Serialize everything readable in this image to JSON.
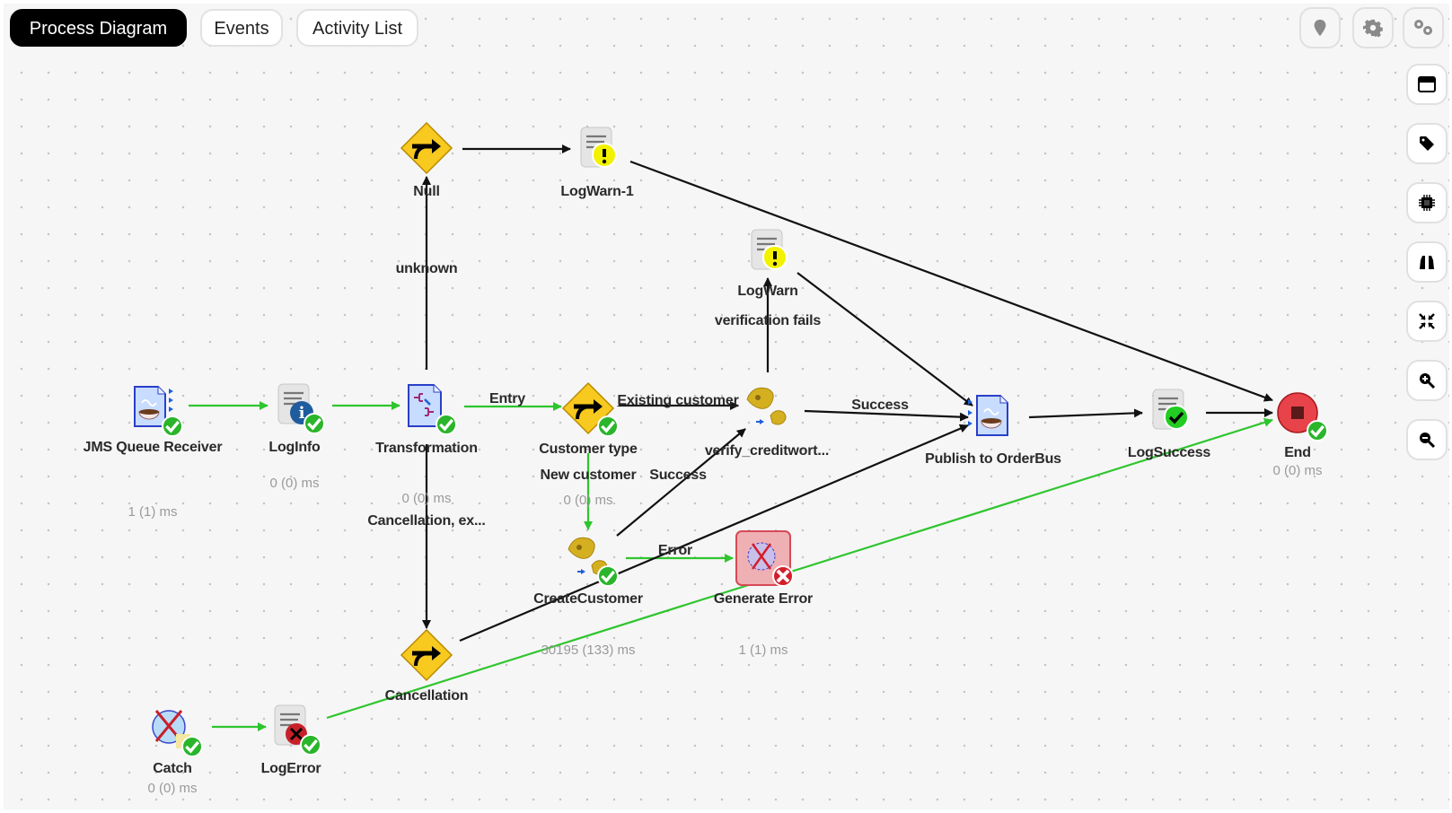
{
  "tabs": [
    {
      "label": "Process Diagram",
      "active": true
    },
    {
      "label": "Events",
      "active": false
    },
    {
      "label": "Activity List",
      "active": false
    }
  ],
  "top_tools": [
    {
      "icon": "map-pin-icon",
      "label": "Location"
    },
    {
      "icon": "gear-icon",
      "label": "Settings"
    },
    {
      "icon": "gears-icon",
      "label": "Advanced settings"
    }
  ],
  "side_tools": [
    {
      "icon": "window-icon"
    },
    {
      "icon": "tag-icon"
    },
    {
      "icon": "chip-icon"
    },
    {
      "icon": "binoculars-icon"
    },
    {
      "icon": "collapse-icon"
    },
    {
      "icon": "zoom-in-icon"
    },
    {
      "icon": "zoom-out-icon"
    }
  ],
  "colors": {
    "success_edge": "#2ec52e",
    "default_edge": "#111111",
    "status_ok": "#2ab52a",
    "status_error": "#d51d2a",
    "active_tab": "#000000",
    "canvas": "#f6f6f6"
  },
  "nodes": [
    {
      "id": "jms",
      "label": "JMS Queue Receiver",
      "type": "jms-receiver",
      "status": "ok",
      "timing": "1 (1) ms"
    },
    {
      "id": "loginfo",
      "label": "LogInfo",
      "type": "log-info",
      "status": "ok",
      "timing": "0 (0) ms"
    },
    {
      "id": "transformation",
      "label": "Transformation",
      "type": "mapper",
      "status": "ok",
      "timing": "0 (0) ms"
    },
    {
      "id": "null",
      "label": "Null",
      "type": "router",
      "status": "none",
      "timing": ""
    },
    {
      "id": "logwarn1",
      "label": "LogWarn-1",
      "type": "log-warn",
      "status": "none",
      "timing": ""
    },
    {
      "id": "customertype",
      "label": "Customer type",
      "type": "router",
      "status": "ok",
      "timing": "0 (0) ms"
    },
    {
      "id": "verify",
      "label": "verify_creditwort...",
      "type": "subprocess",
      "status": "none",
      "timing": ""
    },
    {
      "id": "logwarn",
      "label": "LogWarn",
      "type": "log-warn",
      "status": "none",
      "timing": ""
    },
    {
      "id": "publish",
      "label": "Publish to OrderBus",
      "type": "jms-publisher",
      "status": "none",
      "timing": ""
    },
    {
      "id": "logsuccess",
      "label": "LogSuccess",
      "type": "log-success",
      "status": "none",
      "timing": ""
    },
    {
      "id": "end",
      "label": "End",
      "type": "end",
      "status": "ok",
      "timing": "0 (0) ms"
    },
    {
      "id": "createcustomer",
      "label": "CreateCustomer",
      "type": "subprocess",
      "status": "ok",
      "timing": "30195 (133) ms"
    },
    {
      "id": "generateerror",
      "label": "Generate Error",
      "type": "generate-error",
      "status": "error",
      "timing": "1 (1) ms"
    },
    {
      "id": "cancellation",
      "label": "Cancellation",
      "type": "router",
      "status": "none",
      "timing": ""
    },
    {
      "id": "catch",
      "label": "Catch",
      "type": "catch",
      "status": "ok",
      "timing": "0 (0) ms"
    },
    {
      "id": "logerror",
      "label": "LogError",
      "type": "log-error",
      "status": "ok",
      "timing": ""
    }
  ],
  "edges": [
    {
      "from": "jms",
      "to": "loginfo",
      "label": "",
      "executed": true
    },
    {
      "from": "loginfo",
      "to": "transformation",
      "label": "",
      "executed": true
    },
    {
      "from": "transformation",
      "to": "customertype",
      "label": "Entry",
      "executed": true
    },
    {
      "from": "transformation",
      "to": "null",
      "label": "unknown",
      "executed": false
    },
    {
      "from": "transformation",
      "to": "cancellation",
      "label": "Cancellation, ex...",
      "executed": false
    },
    {
      "from": "null",
      "to": "logwarn1",
      "label": "",
      "executed": false
    },
    {
      "from": "logwarn1",
      "to": "end",
      "label": "",
      "executed": false
    },
    {
      "from": "customertype",
      "to": "verify",
      "label": "Existing customer",
      "executed": false
    },
    {
      "from": "customertype",
      "to": "createcustomer",
      "label": "New customer",
      "executed": true
    },
    {
      "from": "createcustomer",
      "to": "verify",
      "label": "Success",
      "executed": false
    },
    {
      "from": "createcustomer",
      "to": "generateerror",
      "label": "Error",
      "executed": true
    },
    {
      "from": "verify",
      "to": "logwarn",
      "label": "verification fails",
      "executed": false
    },
    {
      "from": "verify",
      "to": "publish",
      "label": "Success",
      "executed": false
    },
    {
      "from": "logwarn",
      "to": "publish",
      "label": "",
      "executed": false
    },
    {
      "from": "cancellation",
      "to": "publish",
      "label": "",
      "executed": false
    },
    {
      "from": "publish",
      "to": "logsuccess",
      "label": "",
      "executed": false
    },
    {
      "from": "logsuccess",
      "to": "end",
      "label": "",
      "executed": false
    },
    {
      "from": "catch",
      "to": "logerror",
      "label": "",
      "executed": true
    },
    {
      "from": "logerror",
      "to": "end",
      "label": "",
      "executed": true
    }
  ]
}
